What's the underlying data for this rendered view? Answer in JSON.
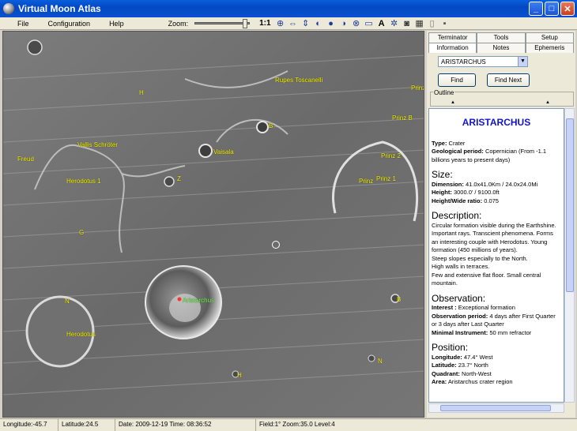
{
  "window": {
    "title": "Virtual Moon Atlas",
    "minimize": "_",
    "maximize": "□",
    "close": "✕"
  },
  "menu": {
    "items": [
      "File",
      "Configuration",
      "Help"
    ],
    "zoom_label": "Zoom:",
    "zoom_ratio": "1:1"
  },
  "toolbar_icons": [
    "grid-icon",
    "flip-horizontal-icon",
    "flip-vertical-icon",
    "moon-phase-icon",
    "shading-icon",
    "libration-icon",
    "globe-icon",
    "scale-icon",
    "font-icon",
    "settings-icon",
    "camera-icon",
    "calendar-icon",
    "page-icon",
    "window-icon"
  ],
  "map": {
    "labels": [
      {
        "text": "Rupes Toscanelli",
        "color": "yellow"
      },
      {
        "text": "H",
        "color": "yellow"
      },
      {
        "text": "B",
        "color": "yellow"
      },
      {
        "text": "Prinz",
        "color": "yellow"
      },
      {
        "text": "Prinz B",
        "color": "yellow"
      },
      {
        "text": "Vallis Schröter",
        "color": "yellow"
      },
      {
        "text": "Freud",
        "color": "yellow"
      },
      {
        "text": "Vaisala",
        "color": "yellow"
      },
      {
        "text": "Prinz 2",
        "color": "yellow"
      },
      {
        "text": "Herodotus 1",
        "color": "yellow"
      },
      {
        "text": "Z",
        "color": "yellow"
      },
      {
        "text": "Prinz",
        "color": "yellow"
      },
      {
        "text": "Prinz 1",
        "color": "yellow"
      },
      {
        "text": "G",
        "color": "yellow"
      },
      {
        "text": "Aristarchus",
        "color": "green"
      },
      {
        "text": "N",
        "color": "yellow"
      },
      {
        "text": "B",
        "color": "yellow"
      },
      {
        "text": "Herodotus",
        "color": "yellow"
      },
      {
        "text": "N",
        "color": "yellow"
      },
      {
        "text": "H",
        "color": "yellow"
      }
    ]
  },
  "panel": {
    "tabs_row1": [
      "Terminator",
      "Tools",
      "Setup"
    ],
    "tabs_row2": [
      "Information",
      "Notes",
      "Ephemeris"
    ],
    "active_tab": "Information",
    "selected_feature": "ARISTARCHUS",
    "find_button": "Find",
    "find_next_button": "Find Next",
    "outline_label": "Outline",
    "info": {
      "name": "ARISTARCHUS",
      "type_label": "Type:",
      "type_value": "Crater",
      "geo_label": "Geological period:",
      "geo_value": "Copernician (From -1.1 billions years to present days)",
      "size_heading": "Size:",
      "dim_label": "Dimension:",
      "dim_value": "41.0x41.0Km / 24.0x24.0Mi",
      "height_label": "Height:",
      "height_value": "3000.0' / 9100.0ft",
      "hw_label": "Height/Wide ratio:",
      "hw_value": "0.075",
      "desc_heading": "Description:",
      "desc_lines": [
        "Circular formation visible during the Earthshine. Important rays. Transcient phenomena. Forms an interesting couple with Herodotus. Young formation (450 millions of years).",
        "Steep slopes especially to the North.",
        "High walls in terraces.",
        "Few and extensive flat floor. Small central mountain."
      ],
      "obs_heading": "Observation:",
      "interest_label": "Interest :",
      "interest_value": "Exceptional formation",
      "period_label": "Observation period:",
      "period_value": "4 days after First Quarter or 3 days after Last Quarter",
      "instr_label": "Minimal Instrument:",
      "instr_value": "50 mm refractor",
      "pos_heading": "Position:",
      "lon_label": "Longitude:",
      "lon_value": "47.4° West",
      "lat_label": "Latitude:",
      "lat_value": "23.7° North",
      "quad_label": "Quadrant:",
      "quad_value": "North-West",
      "area_label": "Area:",
      "area_value": "Aristarchus crater region"
    }
  },
  "status": {
    "longitude": "Longitude:-45.7",
    "latitude": "Latitude:24.5",
    "datetime": "Date: 2009-12-19   Time: 08:36:52",
    "view": "Field:1° Zoom:35.0  Level:4"
  }
}
